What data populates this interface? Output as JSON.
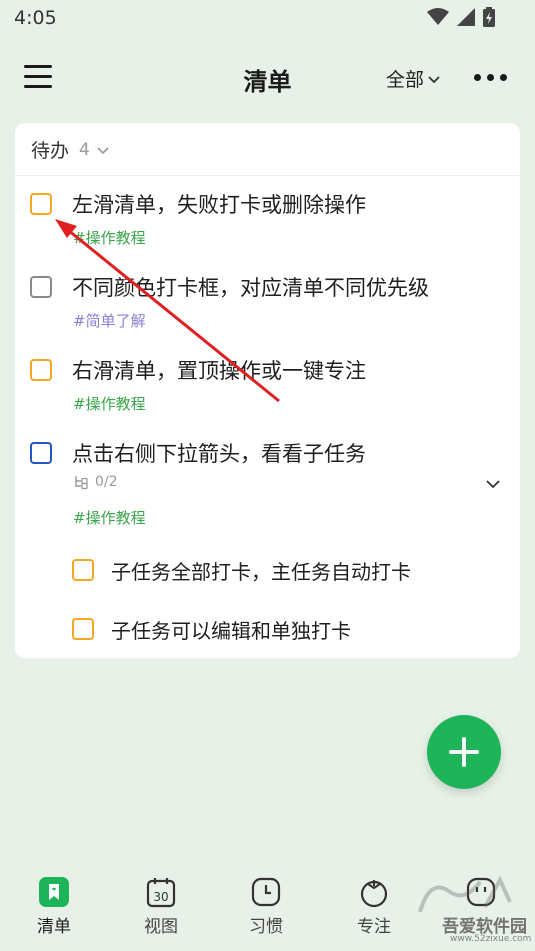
{
  "status_bar": {
    "time": "4:05"
  },
  "app_bar": {
    "title": "清单",
    "filter_label": "全部"
  },
  "section": {
    "title": "待办",
    "count": "4"
  },
  "tasks": [
    {
      "title": "左滑清单，失败打卡或删除操作",
      "tag": "#操作教程",
      "checkbox_color": "#f5a623",
      "tag_color": "#3aa64a"
    },
    {
      "title": "不同颜色打卡框，对应清单不同优先级",
      "tag": "#简单了解",
      "checkbox_color": "#8a8a8a",
      "tag_color": "#8a7fd1"
    },
    {
      "title": "右滑清单，置顶操作或一键专注",
      "tag": "#操作教程",
      "checkbox_color": "#f5a623",
      "tag_color": "#3aa64a"
    },
    {
      "title": "点击右侧下拉箭头，看看子任务",
      "subtask_progress": "0/2",
      "tag": "#操作教程",
      "checkbox_color": "#2457c5",
      "tag_color": "#3aa64a"
    }
  ],
  "subtasks": [
    {
      "title": "子任务全部打卡，主任务自动打卡",
      "checkbox_color": "#f5a623"
    },
    {
      "title": "子任务可以编辑和单独打卡",
      "checkbox_color": "#f5a623"
    }
  ],
  "bottom_nav": {
    "items": [
      {
        "label": "清单",
        "icon": "list-bookmark-icon",
        "active": true
      },
      {
        "label": "视图",
        "icon": "calendar-30-icon",
        "calendar_day": "30"
      },
      {
        "label": "习惯",
        "icon": "clock-icon"
      },
      {
        "label": "专注",
        "icon": "tomato-timer-icon"
      },
      {
        "label": "",
        "icon": "face-icon"
      }
    ]
  },
  "watermark": {
    "text": "吾爱软件园",
    "url": "www.52zixue.com"
  },
  "colors": {
    "accent": "#1db45a",
    "background": "#e8f1e8",
    "annotation_arrow": "#e02020"
  }
}
